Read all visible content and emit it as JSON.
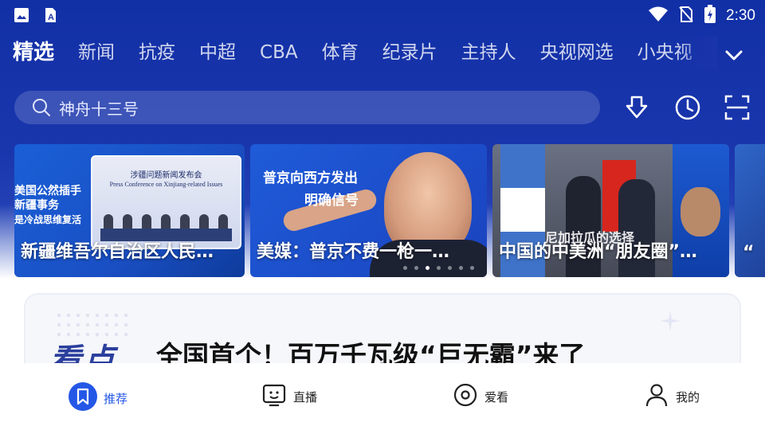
{
  "status_bar": {
    "time": "2:30",
    "icons": [
      "image-icon",
      "a-icon",
      "wifi-icon",
      "no-sim-icon",
      "battery-charging-icon"
    ]
  },
  "tabs": [
    {
      "label": "精选",
      "active": true
    },
    {
      "label": "新闻"
    },
    {
      "label": "抗疫"
    },
    {
      "label": "中超"
    },
    {
      "label": "CBA"
    },
    {
      "label": "体育"
    },
    {
      "label": "纪录片"
    },
    {
      "label": "主持人"
    },
    {
      "label": "央视网选"
    },
    {
      "label": "小央视"
    }
  ],
  "search": {
    "placeholder": "神舟十三号"
  },
  "header_icons": [
    "download-icon",
    "history-icon",
    "scan-icon"
  ],
  "carousel": {
    "cards": [
      {
        "caption": "新疆维吾尔自治区人民…",
        "overlay_lines": [
          "美国公然插手",
          "新疆事务",
          "是冷战思维复活"
        ],
        "panel_title": "涉疆问题新闻发布会",
        "panel_subtitle": "Press Conference on Xinjiang-related Issues"
      },
      {
        "caption": "美媒：普京不费一枪一…",
        "overlay_lines": [
          "普京向西方发出",
          "明确信号"
        ]
      },
      {
        "caption": "中国的中美洲“朋友圈”…",
        "overlay_text": "尼加拉瓜的选择"
      },
      {
        "caption": "“"
      }
    ],
    "dots": 7,
    "active_dot": 2
  },
  "feature": {
    "tag": "看点",
    "headline": "全国首个！百万千瓦级“巨无霸”来了"
  },
  "bottom_nav": [
    {
      "label": "推荐",
      "icon": "bookmark-icon",
      "active": true
    },
    {
      "label": "直播",
      "icon": "tv-icon"
    },
    {
      "label": "爱看",
      "icon": "disc-icon"
    },
    {
      "label": "我的",
      "icon": "person-icon"
    }
  ],
  "colors": {
    "header_blue": "#1a34ab",
    "active_nav": "#2457e6"
  }
}
